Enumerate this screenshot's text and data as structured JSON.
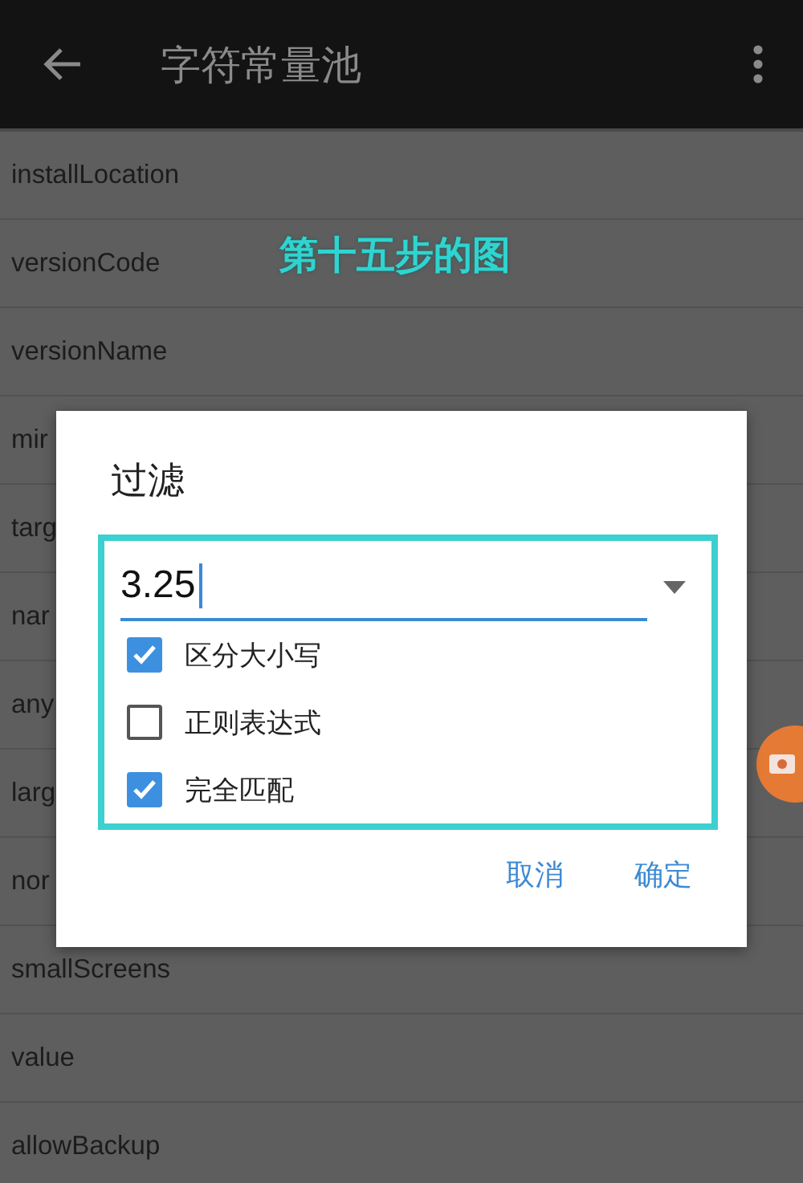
{
  "app_bar": {
    "title": "字符常量池"
  },
  "list": {
    "items": [
      "installLocation",
      "versionCode",
      "versionName",
      "mir",
      "targ",
      "nar",
      "any",
      "larg",
      "nor",
      "smallScreens",
      "value",
      "allowBackup"
    ]
  },
  "annotation": "第十五步的图",
  "dialog": {
    "title": "过滤",
    "filter": {
      "value": "3.25"
    },
    "options": [
      {
        "label": "区分大小写",
        "checked": true
      },
      {
        "label": "正则表达式",
        "checked": false
      },
      {
        "label": "完全匹配",
        "checked": true
      }
    ],
    "buttons": [
      "取消",
      "确定"
    ]
  }
}
